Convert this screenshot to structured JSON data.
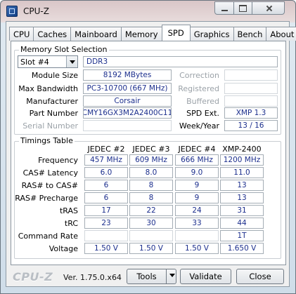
{
  "window": {
    "title": "CPU-Z"
  },
  "tabs": [
    "CPU",
    "Caches",
    "Mainboard",
    "Memory",
    "SPD",
    "Graphics",
    "Bench",
    "About"
  ],
  "active_tab": "SPD",
  "memory_slot": {
    "title": "Memory Slot Selection",
    "slot_value": "Slot #4",
    "type": "DDR3",
    "labels": {
      "module_size": "Module Size",
      "max_bandwidth": "Max Bandwidth",
      "manufacturer": "Manufacturer",
      "part_number": "Part Number",
      "serial_number": "Serial Number",
      "correction": "Correction",
      "registered": "Registered",
      "buffered": "Buffered",
      "spd_ext": "SPD Ext.",
      "week_year": "Week/Year"
    },
    "values": {
      "module_size": "8192 MBytes",
      "max_bandwidth": "PC3-10700 (667 MHz)",
      "manufacturer": "Corsair",
      "part_number": "CMY16GX3M2A2400C11",
      "serial_number": "",
      "correction": "",
      "registered": "",
      "buffered": "",
      "spd_ext": "XMP 1.3",
      "week_year": "13 / 16"
    }
  },
  "timings": {
    "title": "Timings Table",
    "columns": [
      "JEDEC #2",
      "JEDEC #3",
      "JEDEC #4",
      "XMP-2400"
    ],
    "rows": [
      {
        "label": "Frequency",
        "values": [
          "457 MHz",
          "609 MHz",
          "666 MHz",
          "1200 MHz"
        ]
      },
      {
        "label": "CAS# Latency",
        "values": [
          "6.0",
          "8.0",
          "9.0",
          "11.0"
        ]
      },
      {
        "label": "RAS# to CAS#",
        "values": [
          "6",
          "8",
          "9",
          "13"
        ]
      },
      {
        "label": "RAS# Precharge",
        "values": [
          "6",
          "8",
          "9",
          "13"
        ]
      },
      {
        "label": "tRAS",
        "values": [
          "17",
          "22",
          "24",
          "31"
        ]
      },
      {
        "label": "tRC",
        "values": [
          "23",
          "30",
          "33",
          "44"
        ]
      },
      {
        "label": "Command Rate",
        "values": [
          "",
          "",
          "",
          "1T"
        ]
      },
      {
        "label": "Voltage",
        "values": [
          "1.50 V",
          "1.50 V",
          "1.50 V",
          "1.650 V"
        ]
      }
    ]
  },
  "footer": {
    "logo": "CPU-Z",
    "version": "Ver. 1.75.0.x64",
    "tools": "Tools",
    "validate": "Validate",
    "close": "Close"
  },
  "colors": {
    "value_text": "#1c2f8d"
  }
}
